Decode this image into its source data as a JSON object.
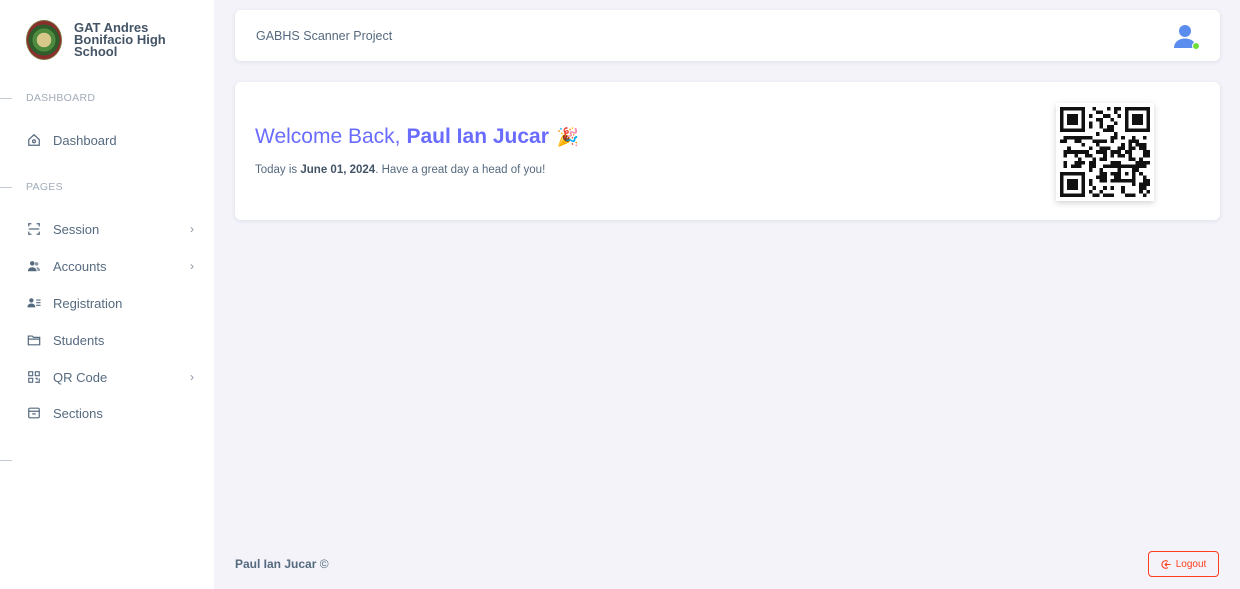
{
  "sidebar": {
    "brand": {
      "name": "GAT Andres Bonifacio High School"
    },
    "sections": [
      {
        "label": "DASHBOARD"
      },
      {
        "label": "PAGES"
      }
    ],
    "items": [
      {
        "label": "Dashboard",
        "icon": "home-icon"
      },
      {
        "label": "Session",
        "icon": "scan-icon",
        "has_submenu": true
      },
      {
        "label": "Accounts",
        "icon": "users-icon",
        "has_submenu": true
      },
      {
        "label": "Registration",
        "icon": "user-list-icon"
      },
      {
        "label": "Students",
        "icon": "folder-icon"
      },
      {
        "label": "QR Code",
        "icon": "qr-scan-icon",
        "has_submenu": true
      },
      {
        "label": "Sections",
        "icon": "archive-icon"
      }
    ]
  },
  "navbar": {
    "title": "GABHS Scanner Project",
    "avatar_status_color": "#71dd37"
  },
  "welcome": {
    "greeting": "Welcome Back,",
    "name": "Paul Ian Jucar",
    "emoji": "🎉",
    "today_prefix": "Today is ",
    "date": "June 01, 2024",
    "today_suffix": ". Have a great day a head of you!"
  },
  "footer": {
    "author": "Paul Ian Jucar",
    "copyright": "©",
    "logout_label": "Logout"
  },
  "colors": {
    "accent": "#696cff",
    "danger": "#ff3e1d",
    "background": "#f3f3f9"
  }
}
